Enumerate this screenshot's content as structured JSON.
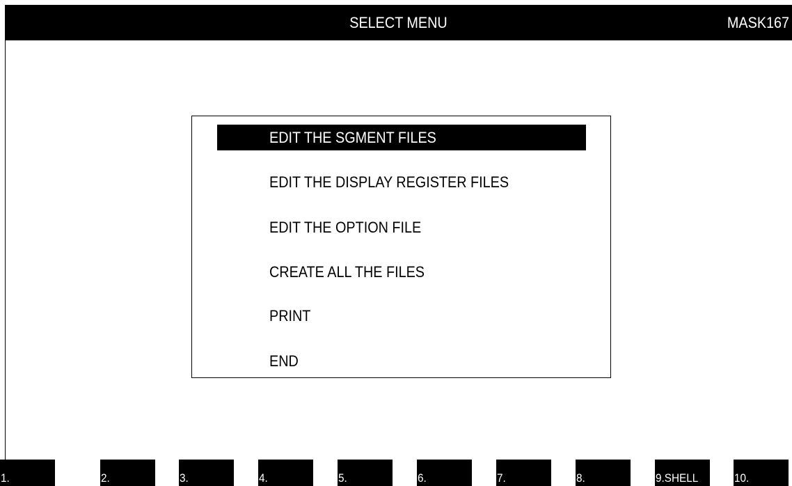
{
  "header": {
    "title": "SELECT MENU",
    "mask_id": "MASK167"
  },
  "menu": {
    "selected_index": 0,
    "items": [
      {
        "label": "EDIT THE SGMENT FILES"
      },
      {
        "label": "EDIT THE DISPLAY REGISTER FILES"
      },
      {
        "label": "EDIT THE OPTION FILE"
      },
      {
        "label": "CREATE ALL THE FILES"
      },
      {
        "label": "PRINT"
      },
      {
        "label": "END"
      }
    ]
  },
  "function_keys": [
    {
      "label": "1."
    },
    {
      "label": "2."
    },
    {
      "label": "3."
    },
    {
      "label": "4."
    },
    {
      "label": "5."
    },
    {
      "label": "6."
    },
    {
      "label": "7."
    },
    {
      "label": "8."
    },
    {
      "label": "9.SHELL"
    },
    {
      "label": "10."
    }
  ],
  "colors": {
    "background": "#ffffff",
    "foreground": "#000000",
    "highlight_bg": "#000000",
    "highlight_fg": "#ffffff"
  }
}
